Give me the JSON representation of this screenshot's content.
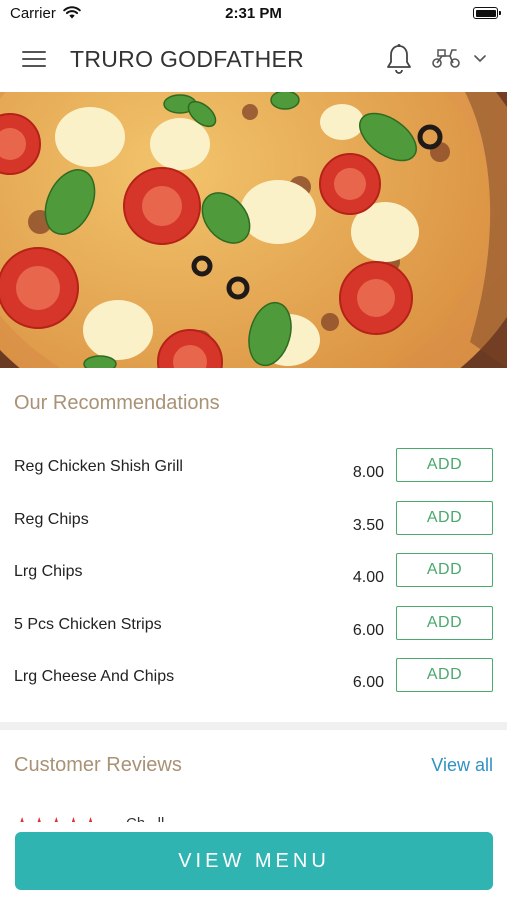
{
  "status_bar": {
    "carrier": "Carrier",
    "time": "2:31 PM"
  },
  "header": {
    "title": "TRURO GODFATHER",
    "icons": [
      "menu-icon",
      "bell-icon",
      "delivery-scooter-icon",
      "chevron-down-icon"
    ]
  },
  "recommendations": {
    "title": "Our Recommendations",
    "items": [
      {
        "name": "Reg Chicken Shish Grill",
        "price": "8.00",
        "button": "ADD"
      },
      {
        "name": "Reg Chips",
        "price": "3.50",
        "button": "ADD"
      },
      {
        "name": "Lrg Chips",
        "price": "4.00",
        "button": "ADD"
      },
      {
        "name": "5 Pcs Chicken Strips",
        "price": "6.00",
        "button": "ADD"
      },
      {
        "name": "Lrg Cheese And Chips",
        "price": "6.00",
        "button": "ADD"
      }
    ]
  },
  "reviews": {
    "title": "Customer Reviews",
    "view_all": "View all",
    "first_review": {
      "stars": "★★★★★",
      "rating": 5,
      "reviewer": "Ch...ll"
    }
  },
  "cta": {
    "label": "VIEW MENU"
  },
  "colors": {
    "accent": "#2fb4b1",
    "add_green": "#4aa96c",
    "section_title": "#a99276",
    "link_blue": "#2f92c5",
    "star_red": "#e03030"
  }
}
